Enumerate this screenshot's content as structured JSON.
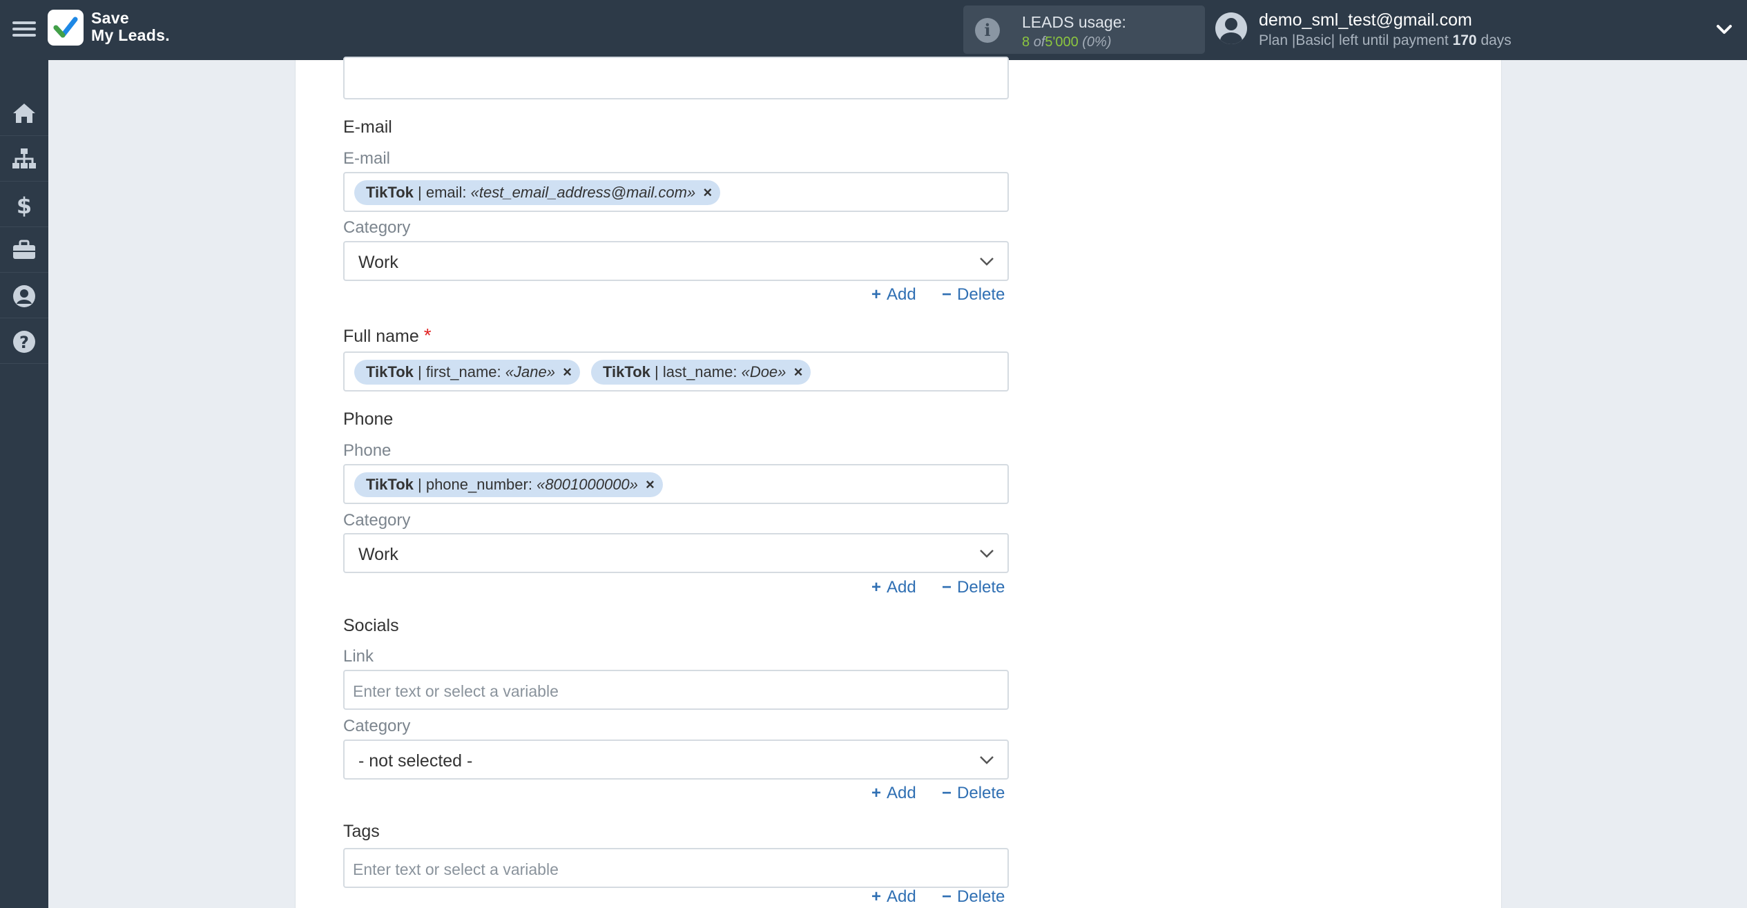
{
  "app": {
    "logo_line1": "Save",
    "logo_line2": "My Leads."
  },
  "usage": {
    "title": "LEADS usage:",
    "used": "8",
    "of_word": "of",
    "total": "5'000",
    "percent": "(0%)"
  },
  "user": {
    "email": "demo_sml_test@gmail.com",
    "plan_prefix": "Plan |Basic| left until payment",
    "days": "170",
    "days_suffix": "days"
  },
  "sidebar": {
    "items": [
      {
        "icon": "home-icon"
      },
      {
        "icon": "sitemap-icon"
      },
      {
        "icon": "dollar-icon"
      },
      {
        "icon": "briefcase-icon"
      },
      {
        "icon": "user-circle-icon"
      },
      {
        "icon": "question-icon"
      }
    ]
  },
  "form": {
    "email_section": {
      "title": "E-mail",
      "field_label": "E-mail",
      "chip": {
        "source": "TikTok",
        "field": "| email:",
        "value": "«test_email_address@mail.com»"
      },
      "category_label": "Category",
      "category_value": "Work"
    },
    "fullname_section": {
      "title": "Full name",
      "required_mark": "*",
      "chips": [
        {
          "source": "TikTok",
          "field": "| first_name:",
          "value": "«Jane»"
        },
        {
          "source": "TikTok",
          "field": "| last_name:",
          "value": "«Doe»"
        }
      ]
    },
    "phone_section": {
      "title": "Phone",
      "field_label": "Phone",
      "chip": {
        "source": "TikTok",
        "field": "| phone_number:",
        "value": "«8001000000»"
      },
      "category_label": "Category",
      "category_value": "Work"
    },
    "socials_section": {
      "title": "Socials",
      "field_label": "Link",
      "placeholder": "Enter text or select a variable",
      "category_label": "Category",
      "category_value": "- not selected -"
    },
    "tags_section": {
      "title": "Tags",
      "placeholder": "Enter text or select a variable"
    },
    "actions": {
      "add_symbol": "+",
      "add_label": "Add",
      "delete_symbol": "−",
      "delete_label": "Delete"
    },
    "remove_symbol": "×"
  },
  "colors": {
    "topbar": "#2d3a48",
    "chip": "#cfe0f3",
    "link": "#2f6fb3",
    "accent_green": "#8cc63f",
    "required": "#e02424"
  }
}
